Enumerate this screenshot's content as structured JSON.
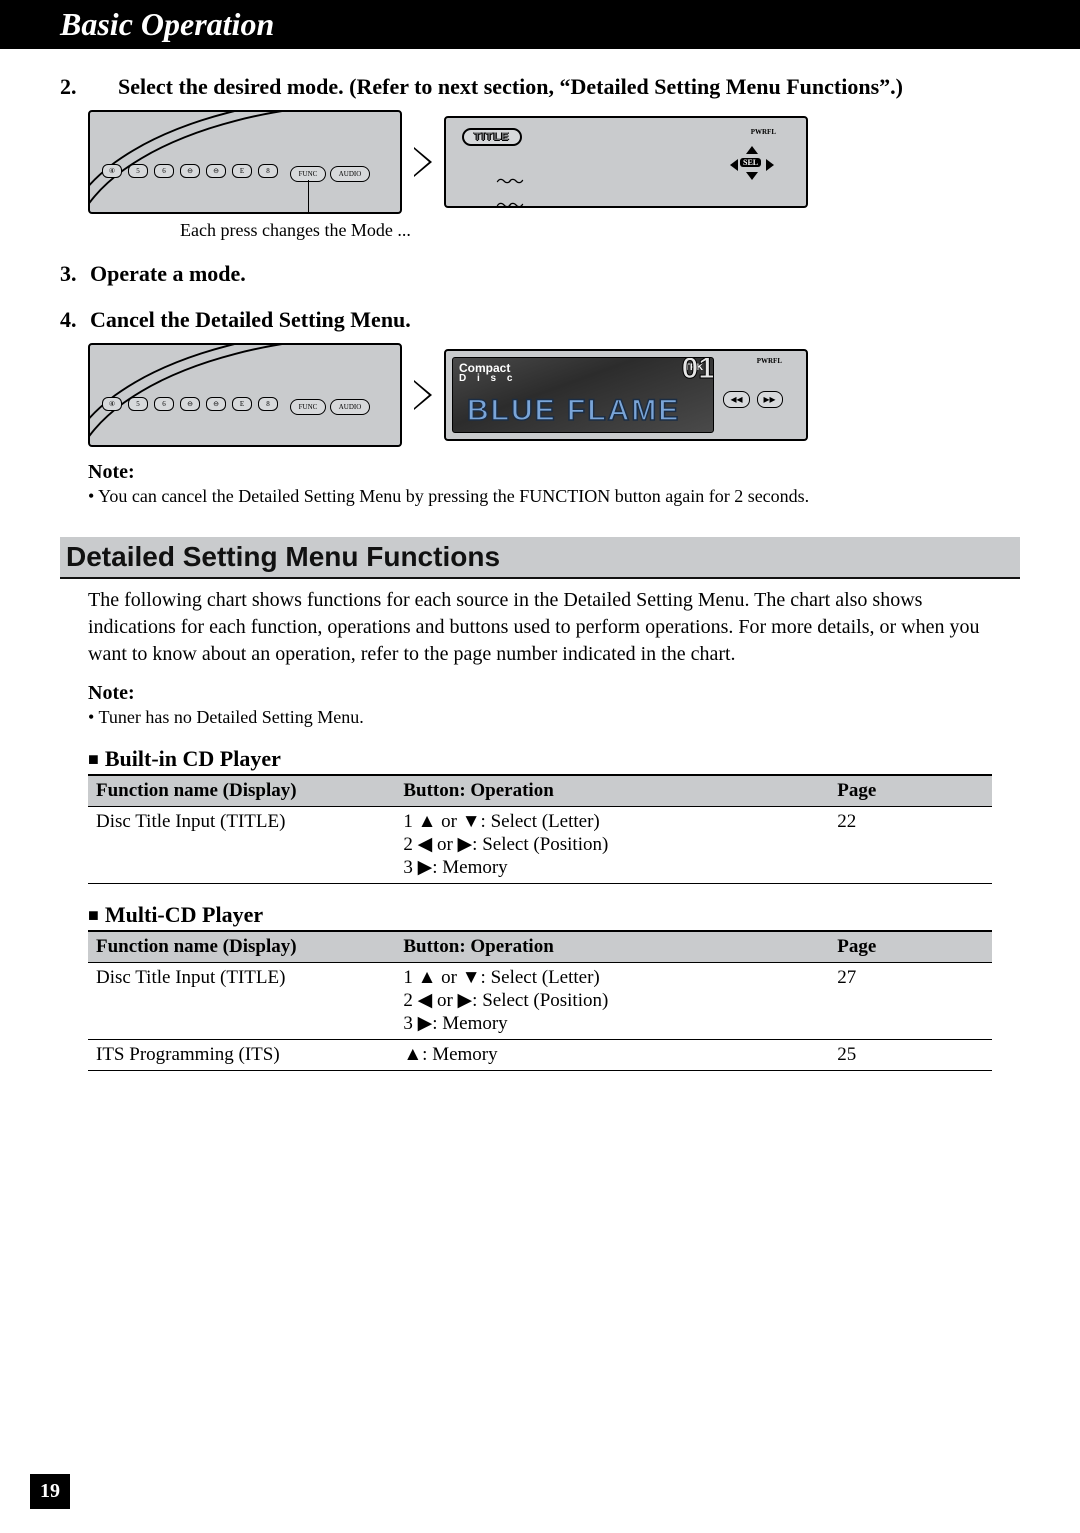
{
  "header": "Basic Operation",
  "steps": {
    "s2_num": "2.",
    "s2_text": "Select the desired mode. (Refer to next section, “Detailed Setting Menu Functions”.)",
    "caption1": "Each press changes the Mode ...",
    "s3_num": "3.",
    "s3_text": "Operate a mode.",
    "s4_num": "4.",
    "s4_text": "Cancel the Detailed Setting Menu."
  },
  "illus": {
    "title_label": "TITLE",
    "sel_label": "SEL",
    "pwr_label": "PWRFL",
    "compact": "Compact",
    "disc": "D i s c",
    "trk": "TRK",
    "trk_num": "01",
    "flame": "BLUE FLAME",
    "func": "FUNC",
    "audio": "AUDIO"
  },
  "note1": {
    "label": "Note:",
    "item": "You can cancel the Detailed Setting Menu by pressing the FUNCTION button again for 2 seconds."
  },
  "section2": {
    "heading": "Detailed Setting Menu Functions",
    "body": "The following chart shows functions for each source in the Detailed Setting Menu. The chart also shows indications for each function, operations and buttons used to perform operations. For more details, or when you want to know about an operation, refer to the page number indicated in the chart.",
    "note_label": "Note:",
    "note_item": "Tuner has no Detailed Setting Menu."
  },
  "tables": {
    "col_func": "Function name (Display)",
    "col_op": "Button: Operation",
    "col_page": "Page",
    "cd": {
      "heading": "Built-in CD Player",
      "rows": [
        {
          "func": "Disc Title Input (TITLE)",
          "op": "1 ▲ or ▼: Select (Letter)\n2 ◀ or ▶: Select (Position)\n3 ▶: Memory",
          "page": "22"
        }
      ]
    },
    "mcd": {
      "heading": "Multi-CD Player",
      "rows": [
        {
          "func": "Disc Title Input (TITLE)",
          "op": "1 ▲ or ▼: Select (Letter)\n2 ◀ or ▶: Select (Position)\n3 ▶: Memory",
          "page": "27"
        },
        {
          "func": "ITS Programming (ITS)",
          "op": "▲: Memory",
          "page": "25"
        }
      ]
    }
  },
  "page_number": "19"
}
